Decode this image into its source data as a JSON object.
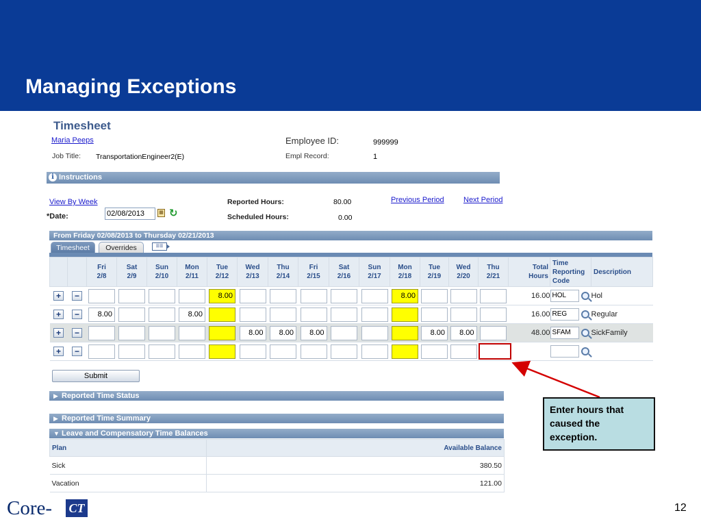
{
  "slide": {
    "title": "Managing Exceptions",
    "page_number": "12",
    "callout": "Enter hours that caused the exception.",
    "logo_text": "Core-",
    "logo_ct": "CT"
  },
  "timesheet": {
    "title": "Timesheet",
    "employee_name": "Maria Peeps",
    "job_title_label": "Job Title:",
    "job_title": "TransportationEngineer2(E)",
    "employee_id_label": "Employee ID:",
    "employee_id": "999999",
    "empl_record_label": "Empl Record:",
    "empl_record": "1",
    "instructions_label": "Instructions",
    "view_by_link": "View By Week",
    "date_label": "*Date:",
    "date_value": "02/08/2013",
    "reported_hours_label": "Reported Hours:",
    "reported_hours": "80.00",
    "scheduled_hours_label": "Scheduled Hours:",
    "scheduled_hours": "0.00",
    "previous_period": "Previous Period",
    "next_period": "Next Period",
    "period_label": "From Friday 02/08/2013 to Thursday 02/21/2013",
    "tabs": [
      "Timesheet",
      "Overrides"
    ],
    "columns": [
      {
        "day": "Fri",
        "date": "2/8"
      },
      {
        "day": "Sat",
        "date": "2/9"
      },
      {
        "day": "Sun",
        "date": "2/10"
      },
      {
        "day": "Mon",
        "date": "2/11"
      },
      {
        "day": "Tue",
        "date": "2/12"
      },
      {
        "day": "Wed",
        "date": "2/13"
      },
      {
        "day": "Thu",
        "date": "2/14"
      },
      {
        "day": "Fri",
        "date": "2/15"
      },
      {
        "day": "Sat",
        "date": "2/16"
      },
      {
        "day": "Sun",
        "date": "2/17"
      },
      {
        "day": "Mon",
        "date": "2/18"
      },
      {
        "day": "Tue",
        "date": "2/19"
      },
      {
        "day": "Wed",
        "date": "2/20"
      },
      {
        "day": "Thu",
        "date": "2/21"
      }
    ],
    "total_header": [
      "Total",
      "Hours"
    ],
    "trc_header": [
      "Time",
      "Reporting",
      "Code"
    ],
    "desc_header": "Description",
    "rows": [
      {
        "cells": [
          "",
          "",
          "",
          "",
          "8.00",
          "",
          "",
          "",
          "",
          "",
          "8.00",
          "",
          "",
          ""
        ],
        "total": "16.00",
        "trc": "HOL",
        "desc": "Hol"
      },
      {
        "cells": [
          "8.00",
          "",
          "",
          "8.00",
          "",
          "",
          "",
          "",
          "",
          "",
          "",
          "",
          "",
          ""
        ],
        "total": "16.00",
        "trc": "REG",
        "desc": "Regular"
      },
      {
        "cells": [
          "",
          "",
          "",
          "",
          "",
          "8.00",
          "8.00",
          "8.00",
          "",
          "",
          "",
          "8.00",
          "8.00",
          ""
        ],
        "total": "48.00",
        "trc": "SFAM",
        "desc": "SickFamily"
      },
      {
        "cells": [
          "",
          "",
          "",
          "",
          "",
          "",
          "",
          "",
          "",
          "",
          "",
          "",
          "",
          ""
        ],
        "total": "",
        "trc": "",
        "desc": ""
      }
    ],
    "plus": "+",
    "minus": "−",
    "submit_label": "Submit",
    "reported_time_status": "Reported Time Status",
    "reported_time_summary": "Reported Time Summary",
    "leave_balances": "Leave and Compensatory Time Balances",
    "balance_headers": {
      "plan": "Plan",
      "available": "Available Balance"
    },
    "balances": [
      {
        "plan": "Sick",
        "available": "380.50"
      },
      {
        "plan": "Vacation",
        "available": "121.00"
      }
    ]
  }
}
